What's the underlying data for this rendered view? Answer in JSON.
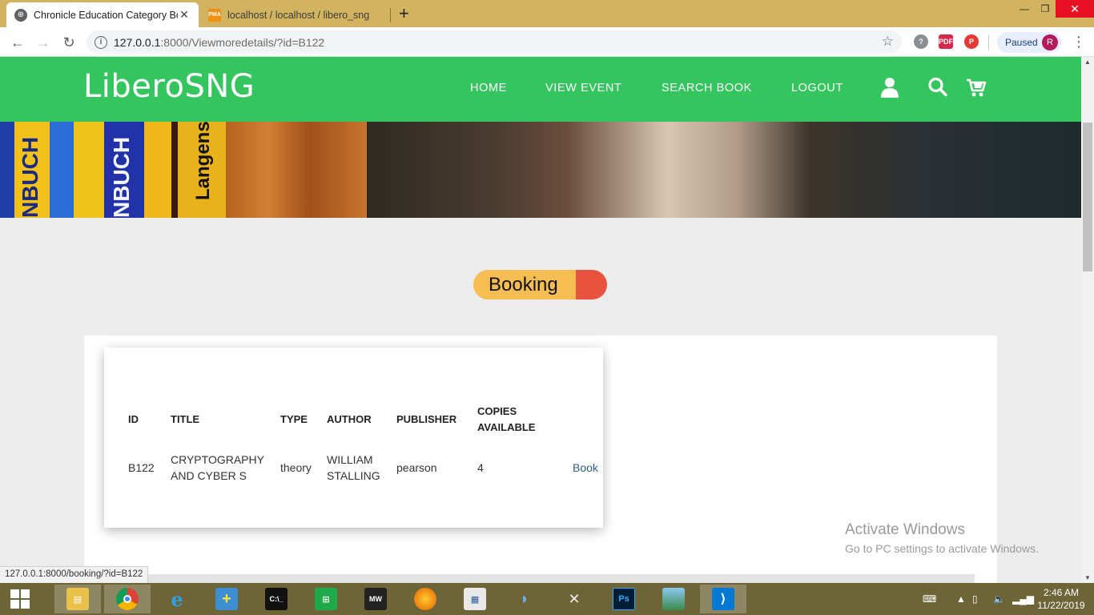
{
  "browser": {
    "tabs": [
      {
        "title": "Chronicle Education Category Bo",
        "favicon": "globe-icon",
        "active": true
      },
      {
        "title": "localhost / localhost / libero_sng",
        "favicon": "phpmyadmin-icon",
        "active": false
      }
    ],
    "address": {
      "host": "127.0.0.1",
      "path": ":8000/Viewmoredetails/?id=B122"
    },
    "profile": {
      "label": "Paused",
      "initial": "R"
    },
    "status_url": "127.0.0.1:8000/booking/?id=B122"
  },
  "site": {
    "logo": "LiberoSNG",
    "nav": [
      "HOME",
      "VIEW EVENT",
      "SEARCH BOOK",
      "LOGOUT"
    ],
    "header_icons": [
      "user-icon",
      "search-icon",
      "cart-icon"
    ],
    "banner_spines": [
      "NBUCH",
      "NBUCH",
      "Langens"
    ],
    "accent": "#35c55f"
  },
  "booking": {
    "heading": "Booking",
    "columns": [
      "ID",
      "TITLE",
      "TYPE",
      "AUTHOR",
      "PUBLISHER",
      "COPIES",
      "AVAILABLE"
    ],
    "row": {
      "id": "B122",
      "title_l1": "CRYPTOGRAPHY",
      "title_l2": "AND CYBER S",
      "type": "theory",
      "author_l1": "WILLIAM",
      "author_l2": "STALLING",
      "publisher": "pearson",
      "copies": "4",
      "action": "Book"
    }
  },
  "watermark": {
    "line1": "Activate Windows",
    "line2": "Go to PC settings to activate Windows."
  },
  "taskbar": {
    "apps": [
      "file-explorer-icon",
      "chrome-icon",
      "internet-explorer-icon",
      "installer-icon",
      "cmd-icon",
      "store-icon",
      "nfs-mw-icon",
      "firefox-icon",
      "reader-icon",
      "dolphin-icon",
      "tools-icon",
      "photoshop-icon",
      "photo-viewer-icon",
      "vscode-icon"
    ],
    "clock_time": "2:46 AM",
    "clock_date": "11/22/2019"
  }
}
